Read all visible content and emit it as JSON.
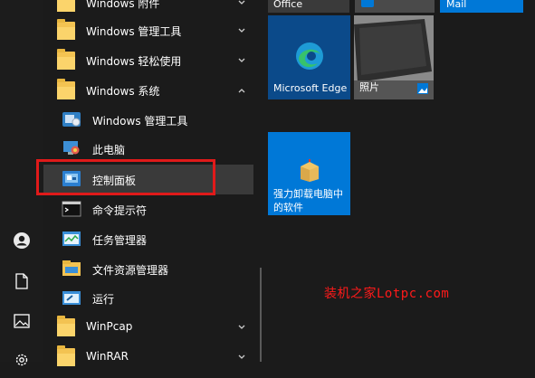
{
  "app_list": {
    "items": [
      {
        "label": "Windows 附件",
        "type": "folder",
        "chevron": "down"
      },
      {
        "label": "Windows 管理工具",
        "type": "folder",
        "chevron": "down"
      },
      {
        "label": "Windows 轻松使用",
        "type": "folder",
        "chevron": "down"
      },
      {
        "label": "Windows 系统",
        "type": "folder",
        "chevron": "up"
      },
      {
        "label": "Windows 管理工具",
        "type": "app",
        "icon": "admin-tools-icon"
      },
      {
        "label": "此电脑",
        "type": "app",
        "icon": "this-pc-icon"
      },
      {
        "label": "控制面板",
        "type": "app",
        "icon": "control-panel-icon",
        "selected": true
      },
      {
        "label": "命令提示符",
        "type": "app",
        "icon": "command-prompt-icon"
      },
      {
        "label": "任务管理器",
        "type": "app",
        "icon": "task-manager-icon"
      },
      {
        "label": "文件资源管理器",
        "type": "app",
        "icon": "file-explorer-icon"
      },
      {
        "label": "运行",
        "type": "app",
        "icon": "run-icon"
      },
      {
        "label": "WinPcap",
        "type": "folder",
        "chevron": "down"
      },
      {
        "label": "WinRAR",
        "type": "folder",
        "chevron": "down"
      }
    ]
  },
  "tiles": {
    "office": "Office",
    "mail": "Mail",
    "edge": "Microsoft Edge",
    "photos": "照片",
    "uninstall_line1": "强力卸载电脑中",
    "uninstall_line2": "的软件"
  },
  "watermark": "装机之家Lotpc.com",
  "colors": {
    "accent": "#0078d7",
    "highlight_box": "#e01a1a",
    "folder": "#f3c352"
  }
}
